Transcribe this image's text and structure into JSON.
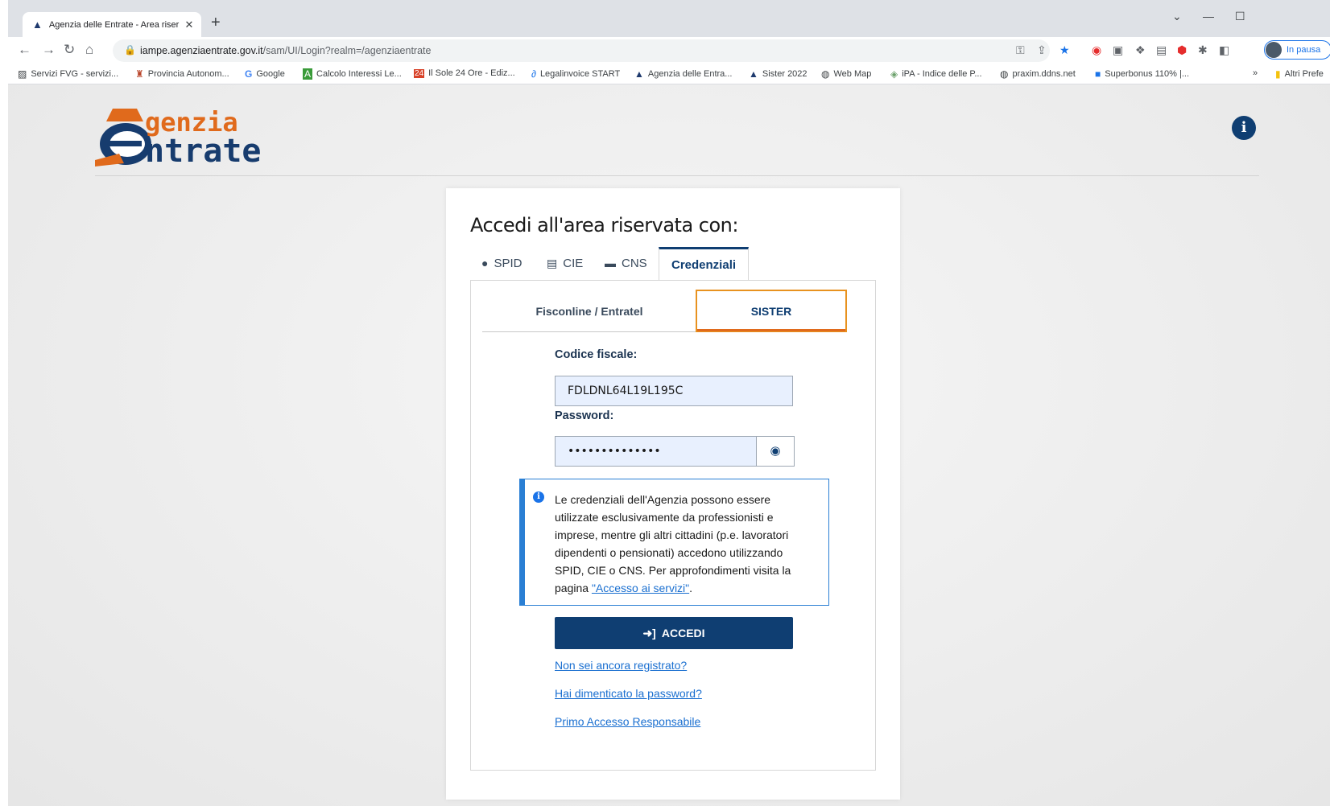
{
  "browser": {
    "tab_title": "Agenzia delle Entrate - Area riser",
    "new_tab": "+",
    "url_host": "iampe.agenziaentrate.gov.it",
    "url_path": "/sam/UI/Login?realm=/agenziaentrate",
    "profile_label": "In pausa",
    "bookmarks": [
      {
        "label": "Servizi FVG - servizi...",
        "icon": "image-icon"
      },
      {
        "label": "Provincia Autonom...",
        "icon": "crest-icon"
      },
      {
        "label": "Google",
        "icon": "google-icon"
      },
      {
        "label": "Calcolo Interessi Le...",
        "icon": "a-icon"
      },
      {
        "label": "Il Sole 24 Ore - Ediz...",
        "icon": "24-icon"
      },
      {
        "label": "Legalinvoice START",
        "icon": "swirl-icon"
      },
      {
        "label": "Agenzia delle Entra...",
        "icon": "agenzia-icon"
      },
      {
        "label": "Sister 2022",
        "icon": "agenzia-icon"
      },
      {
        "label": "Web Map",
        "icon": "globe-icon"
      },
      {
        "label": "iPA - Indice delle P...",
        "icon": "diamond-icon"
      },
      {
        "label": "praxim.ddns.net",
        "icon": "globe-icon"
      },
      {
        "label": "Superbonus 110% |...",
        "icon": "square-icon"
      }
    ],
    "more_bookmarks": "»",
    "other_bookmarks": "Altri Prefe"
  },
  "logo": {
    "line1": "genzia",
    "line2": "ntrate"
  },
  "login": {
    "heading": "Accedi all'area riservata con:",
    "tabs": [
      "SPID",
      "CIE",
      "CNS",
      "Credenziali"
    ],
    "subtabs": [
      "Fisconline / Entratel",
      "SISTER"
    ],
    "codice_label": "Codice fiscale:",
    "codice_value": "FDLDNL64L19L195C",
    "password_label": "Password:",
    "password_value": "••••••••••••••",
    "notice_text": "Le credenziali dell'Agenzia possono essere utilizzate esclusivamente da professionisti e imprese, mentre gli altri cittadini (p.e. lavoratori dipendenti o pensionati) accedono utilizzando SPID, CIE o CNS. Per approfondimenti visita la pagina ",
    "notice_link": "\"Accesso ai servizi\"",
    "notice_end": ".",
    "accedi_label": "ACCEDI",
    "links": [
      "Non sei ancora registrato?",
      "Hai dimenticato la password?",
      "Primo Accesso Responsabile"
    ]
  },
  "colors": {
    "brand_blue": "#0f3e72",
    "brand_orange": "#e06a1c",
    "link": "#1a6fd0"
  }
}
